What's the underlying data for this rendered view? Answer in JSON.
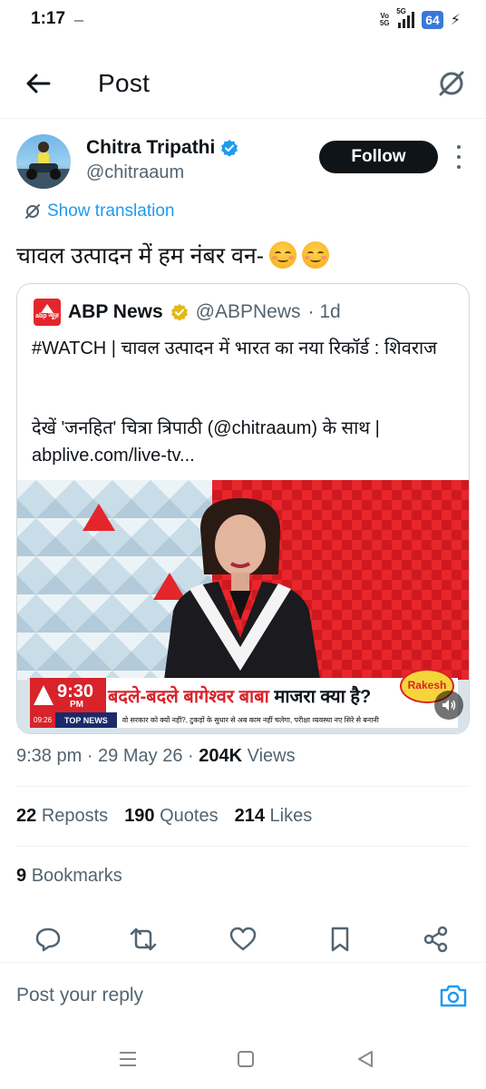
{
  "status_bar": {
    "time": "1:17",
    "volte": "Vo\n5G",
    "network": "5G",
    "battery": "64"
  },
  "header": {
    "title": "Post"
  },
  "author": {
    "name": "Chitra Tripathi",
    "handle": "@chitraaum",
    "follow_label": "Follow"
  },
  "show_translation": "Show translation",
  "tweet_text": "चावल उत्पादन में हम नंबर वन-",
  "quote": {
    "logo_text": "abp न्यूज़",
    "name": "ABP News",
    "handle": "@ABPNews",
    "age": "· 1d",
    "text1": "#WATCH | चावल उत्पादन में भारत का नया रिकॉर्ड : शिवराज",
    "text2": "देखें 'जनहित' चित्रा त्रिपाठी (@chitraaum) के साथ | abplive.com/live-tv...",
    "video": {
      "time": "9:30",
      "pm": "PM",
      "headline_red": "बदले-बदले बागेश्वर बाबा",
      "headline_black": "माजरा क्या है?",
      "sponsor": "Rakesh",
      "clock": "09:26",
      "top_news": "TOP NEWS",
      "ticker": "वो सरकार को क्यों नहीं?, टुकड़ों के सुधार से अब काम नहीं चलेगा, परीक्षा व्यवस्था नए सिरे से बनानी"
    }
  },
  "meta": {
    "time": "9:38 pm",
    "date": "29 May 26",
    "views_count": "204K",
    "views_label": "Views"
  },
  "stats": {
    "reposts_count": "22",
    "reposts_label": "Reposts",
    "quotes_count": "190",
    "quotes_label": "Quotes",
    "likes_count": "214",
    "likes_label": "Likes",
    "bookmarks_count": "9",
    "bookmarks_label": "Bookmarks"
  },
  "reply": {
    "placeholder": "Post your reply"
  },
  "icons": {
    "back": "arrow-left-icon",
    "grok": "grok-icon",
    "verified": "verified-badge-icon",
    "more": "more-vertical-icon",
    "translate": "translate-icon",
    "reply": "reply-icon",
    "repost": "repost-icon",
    "like": "heart-icon",
    "bookmark": "bookmark-icon",
    "share": "share-icon",
    "camera": "camera-icon"
  },
  "colors": {
    "accent": "#1d9bf0",
    "text": "#0f1419",
    "secondary": "#536471",
    "abp_red": "#e3262b",
    "battery": "#3a78d8"
  }
}
